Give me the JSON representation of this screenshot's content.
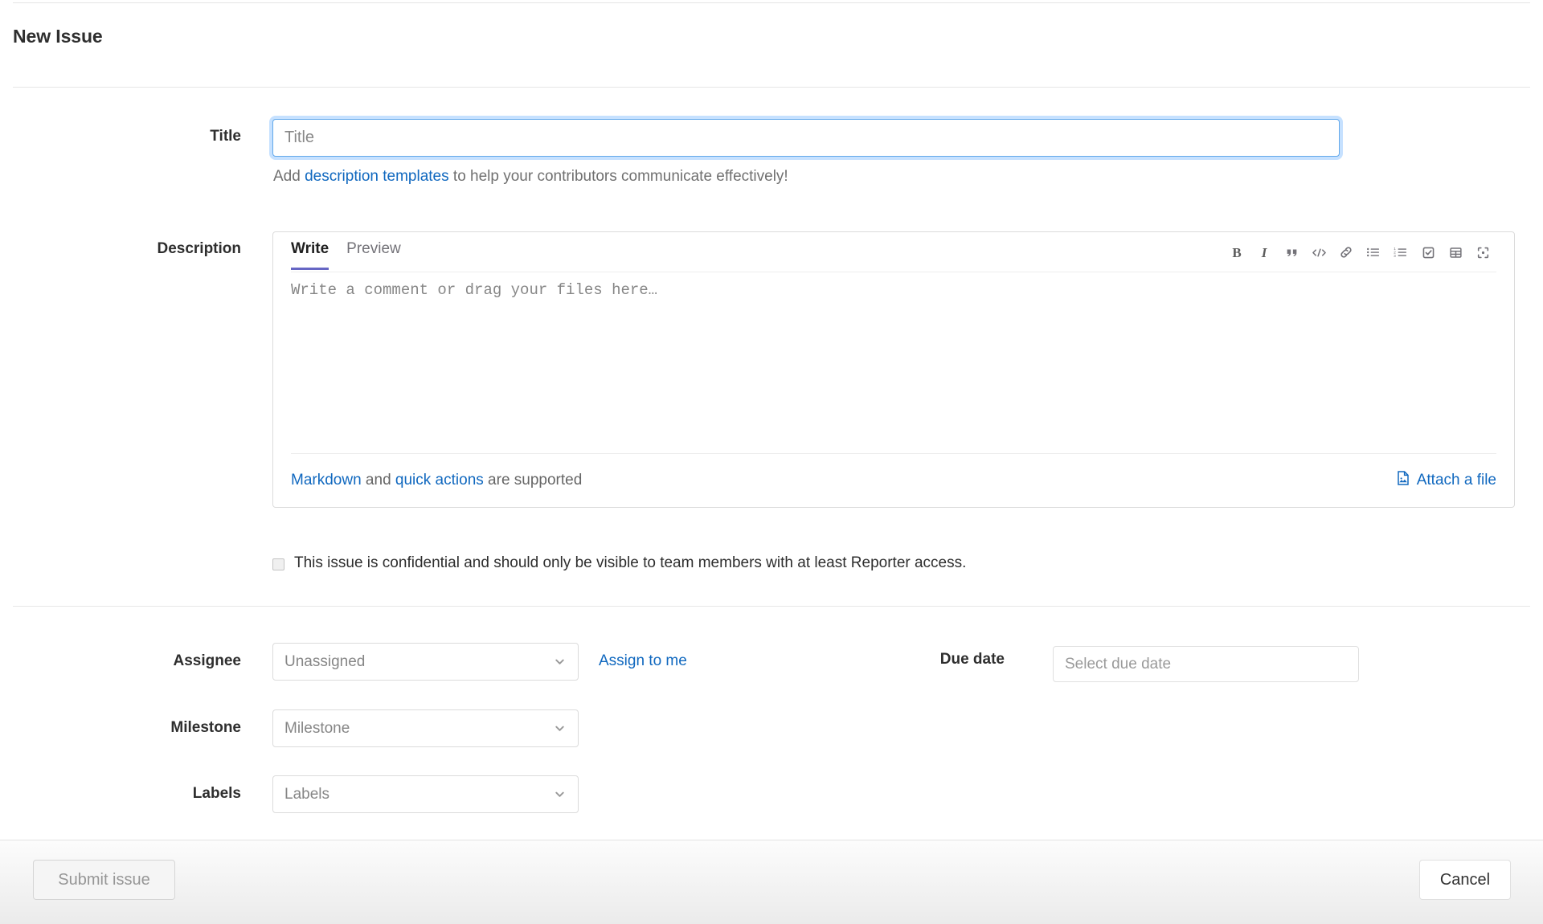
{
  "page": {
    "title": "New Issue"
  },
  "title_field": {
    "label": "Title",
    "value": "",
    "placeholder": "Title",
    "help_prefix": "Add ",
    "help_link": "description templates",
    "help_suffix": " to help your contributors communicate effectively!"
  },
  "description": {
    "label": "Description",
    "tabs": [
      {
        "label": "Write",
        "active": true
      },
      {
        "label": "Preview",
        "active": false
      }
    ],
    "textarea_value": "",
    "textarea_placeholder": "Write a comment or drag your files here…",
    "toolbar": [
      {
        "name": "bold-icon",
        "label": "B"
      },
      {
        "name": "italic-icon",
        "label": "I"
      },
      {
        "name": "quote-icon",
        "label": "””"
      },
      {
        "name": "code-icon",
        "label": "</>"
      },
      {
        "name": "link-icon",
        "label": "link"
      },
      {
        "name": "bullet-list-icon",
        "label": "bullet list"
      },
      {
        "name": "numbered-list-icon",
        "label": "numbered list"
      },
      {
        "name": "task-list-icon",
        "label": "task list"
      },
      {
        "name": "table-icon",
        "label": "table"
      },
      {
        "name": "fullscreen-icon",
        "label": "fullscreen"
      }
    ],
    "footer": {
      "markdown_link": "Markdown",
      "and_text": " and ",
      "quick_actions_link": "quick actions",
      "supported_text": " are supported",
      "attach_label": "Attach a file"
    }
  },
  "confidential": {
    "checked": false,
    "text": "This issue is confidential and should only be visible to team members with at least Reporter access."
  },
  "assignee": {
    "label": "Assignee",
    "value": "Unassigned",
    "assign_to_me": "Assign to me"
  },
  "milestone": {
    "label": "Milestone",
    "value": "Milestone"
  },
  "labels": {
    "label": "Labels",
    "value": "Labels"
  },
  "due_date": {
    "label": "Due date",
    "value": "",
    "placeholder": "Select due date"
  },
  "footer": {
    "submit_label": "Submit issue",
    "cancel_label": "Cancel"
  },
  "colors": {
    "link": "#1068bf",
    "tab_active_underline": "#6666c4",
    "focus_ring": "#62a8ea",
    "text": "#2e2e2e",
    "muted": "#737278"
  }
}
